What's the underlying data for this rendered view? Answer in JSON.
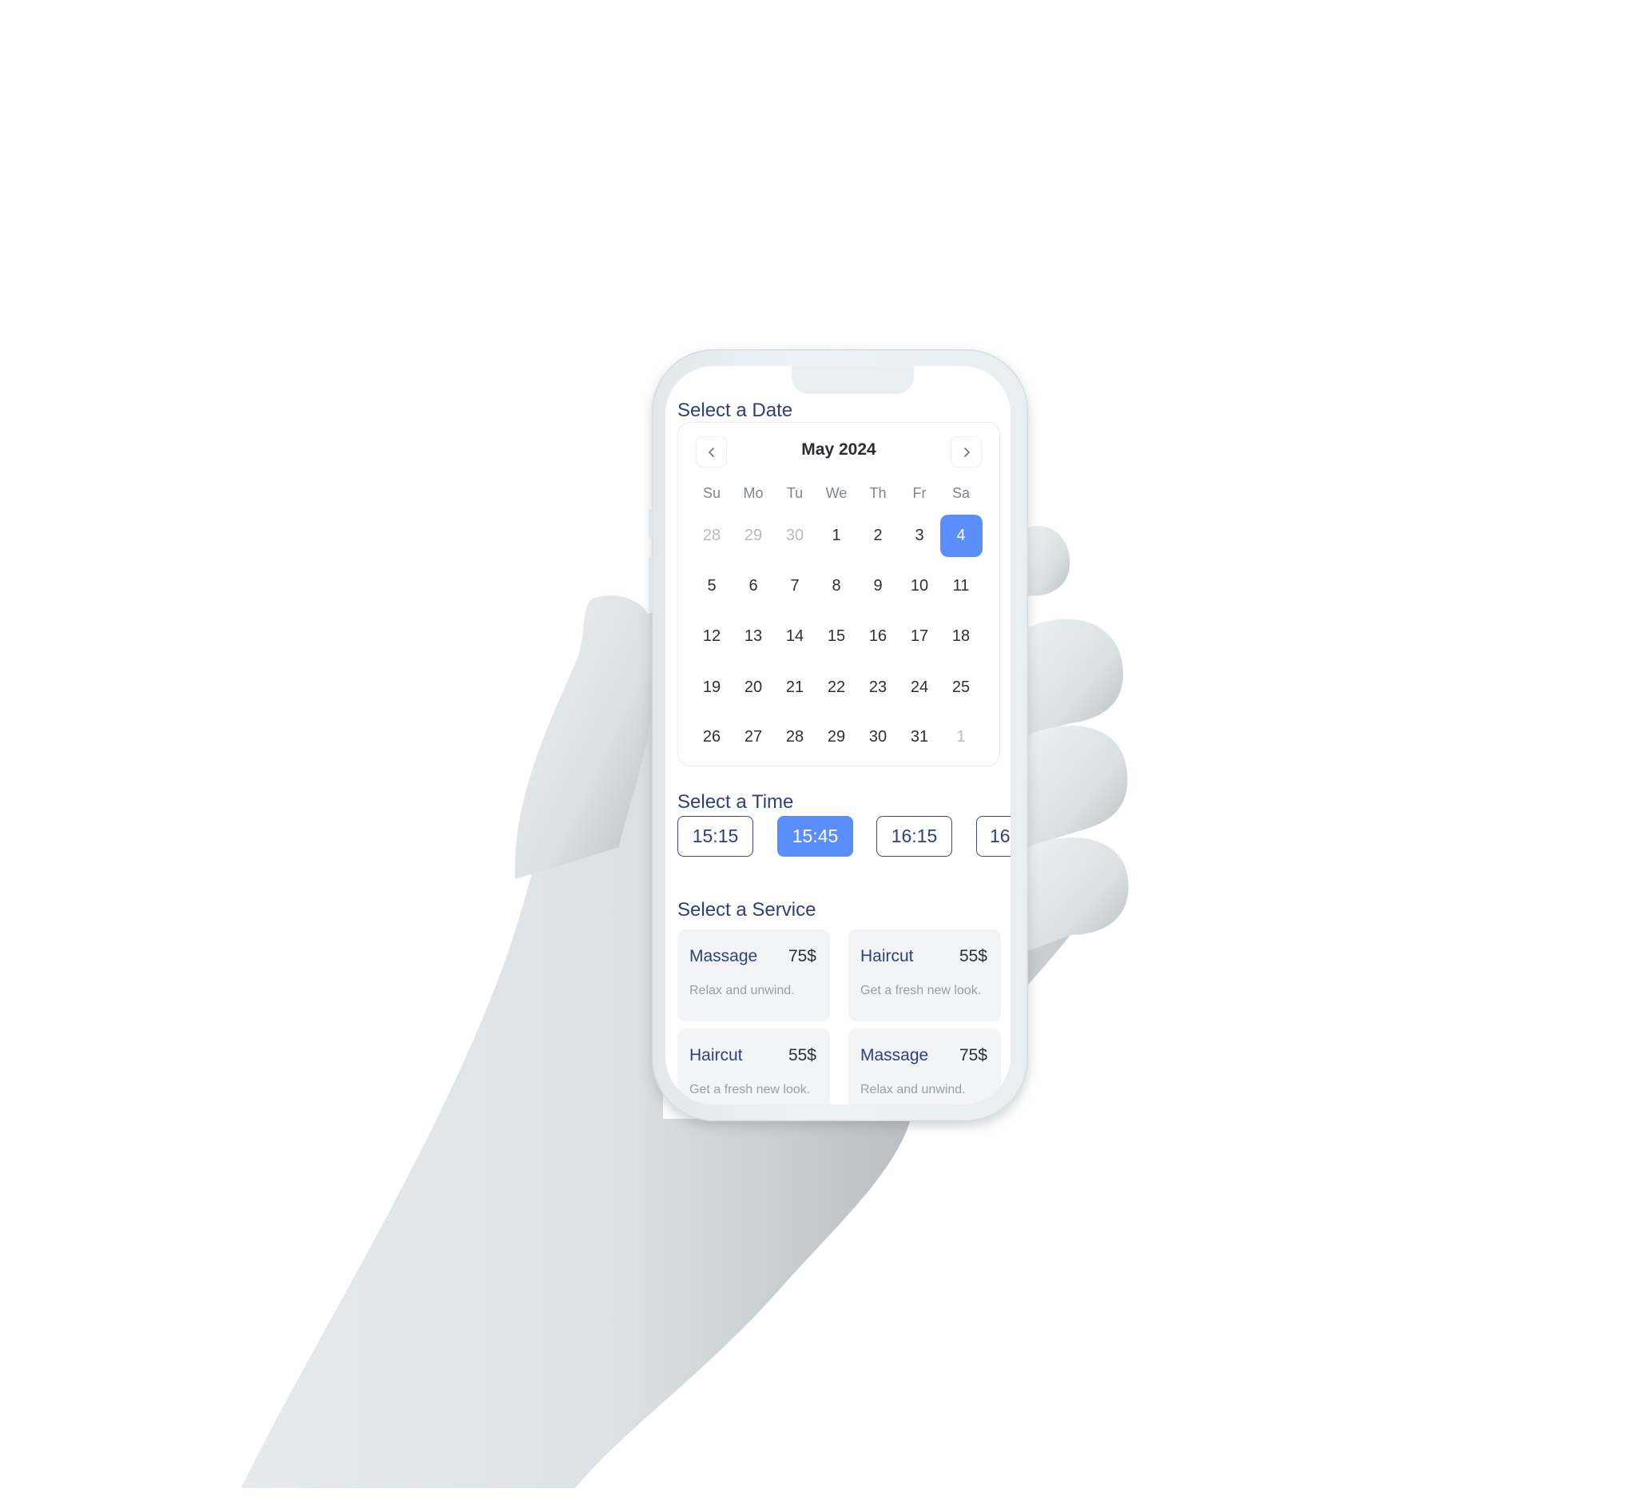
{
  "sections": {
    "date_title": "Select a Date",
    "time_title": "Select a Time",
    "service_title": "Select a Service"
  },
  "calendar": {
    "month_label": "May 2024",
    "prev_icon": "chevron-left-icon",
    "next_icon": "chevron-right-icon",
    "weekdays": [
      "Su",
      "Mo",
      "Tu",
      "We",
      "Th",
      "Fr",
      "Sa"
    ],
    "weeks": [
      [
        {
          "d": "28",
          "muted": true
        },
        {
          "d": "29",
          "muted": true
        },
        {
          "d": "30",
          "muted": true
        },
        {
          "d": "1"
        },
        {
          "d": "2"
        },
        {
          "d": "3"
        },
        {
          "d": "4",
          "selected": true
        }
      ],
      [
        {
          "d": "5"
        },
        {
          "d": "6"
        },
        {
          "d": "7"
        },
        {
          "d": "8"
        },
        {
          "d": "9"
        },
        {
          "d": "10"
        },
        {
          "d": "11"
        }
      ],
      [
        {
          "d": "12"
        },
        {
          "d": "13"
        },
        {
          "d": "14"
        },
        {
          "d": "15"
        },
        {
          "d": "16"
        },
        {
          "d": "17"
        },
        {
          "d": "18"
        }
      ],
      [
        {
          "d": "19"
        },
        {
          "d": "20"
        },
        {
          "d": "21"
        },
        {
          "d": "22"
        },
        {
          "d": "23"
        },
        {
          "d": "24"
        },
        {
          "d": "25"
        }
      ],
      [
        {
          "d": "26"
        },
        {
          "d": "27"
        },
        {
          "d": "28"
        },
        {
          "d": "29"
        },
        {
          "d": "30"
        },
        {
          "d": "31"
        },
        {
          "d": "1",
          "muted": true
        }
      ]
    ],
    "selected_date": "4"
  },
  "times": [
    {
      "label": "15:15",
      "selected": false
    },
    {
      "label": "15:45",
      "selected": true
    },
    {
      "label": "16:15",
      "selected": false
    },
    {
      "label": "16",
      "selected": false
    }
  ],
  "services": [
    {
      "name": "Massage",
      "price": "75$",
      "desc": "Relax and unwind."
    },
    {
      "name": "Haircut",
      "price": "55$",
      "desc": "Get a fresh new look."
    },
    {
      "name": "Haircut",
      "price": "55$",
      "desc": "Get a fresh new look."
    },
    {
      "name": "Massage",
      "price": "75$",
      "desc": "Relax and unwind."
    }
  ],
  "colors": {
    "accent": "#5a8ffb",
    "heading": "#2e3f80",
    "text": "#2c2f33",
    "muted": "#b7bbc0",
    "card_bg": "#f3f4f6"
  }
}
